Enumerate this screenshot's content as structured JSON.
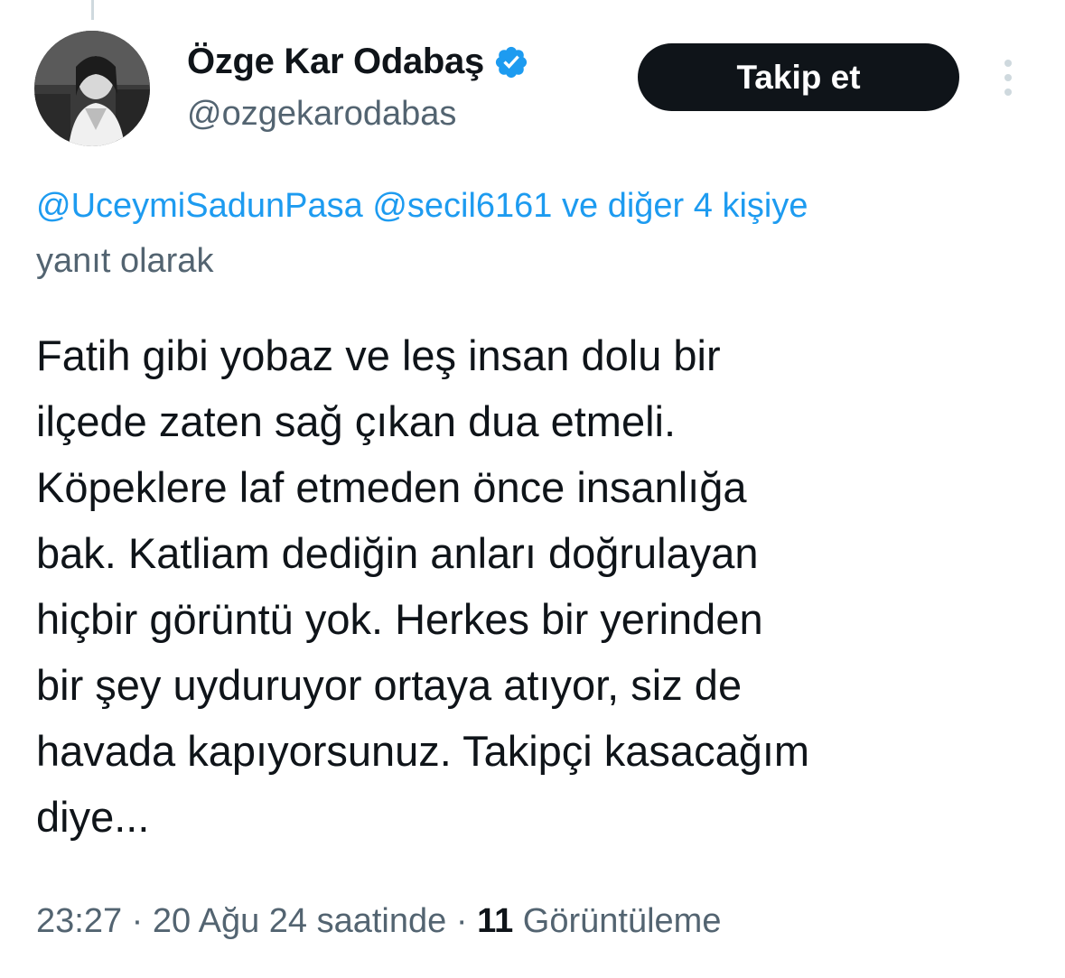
{
  "author": {
    "display_name": "Özge Kar Odabaş",
    "handle": "@ozgekarodabas",
    "verified_icon": "verified-badge-icon",
    "verified_color": "#1d9bf0"
  },
  "actions": {
    "follow_label": "Takip et",
    "more_icon": "more-vertical-icon"
  },
  "reply_to": {
    "mention_1": "@UceymiSadunPasa",
    "mention_2": "@secil6161",
    "others": "ve diğer 4 kişiye",
    "suffix": "yanıt olarak"
  },
  "tweet": {
    "lines": [
      "Fatih gibi yobaz ve leş insan dolu bir",
      "ilçede zaten sağ çıkan dua etmeli.",
      "Köpeklere laf etmeden önce insanlığa",
      "bak. Katliam dediğin anları doğrulayan",
      "hiçbir görüntü yok. Herkes bir yerinden",
      "bir şey uyduruyor ortaya atıyor, siz de",
      "havada kapıyorsunuz. Takipçi kasacağım",
      "diye..."
    ]
  },
  "meta": {
    "time": "23:27",
    "separator_1": "·",
    "date": "20 Ağu 24 saatinde",
    "separator_2": "·",
    "views_count": "11",
    "views_label": "Görüntüleme"
  },
  "colors": {
    "text_primary": "#0f1419",
    "text_secondary": "#536471",
    "link": "#1d9bf0",
    "button_bg": "#0f1419"
  }
}
